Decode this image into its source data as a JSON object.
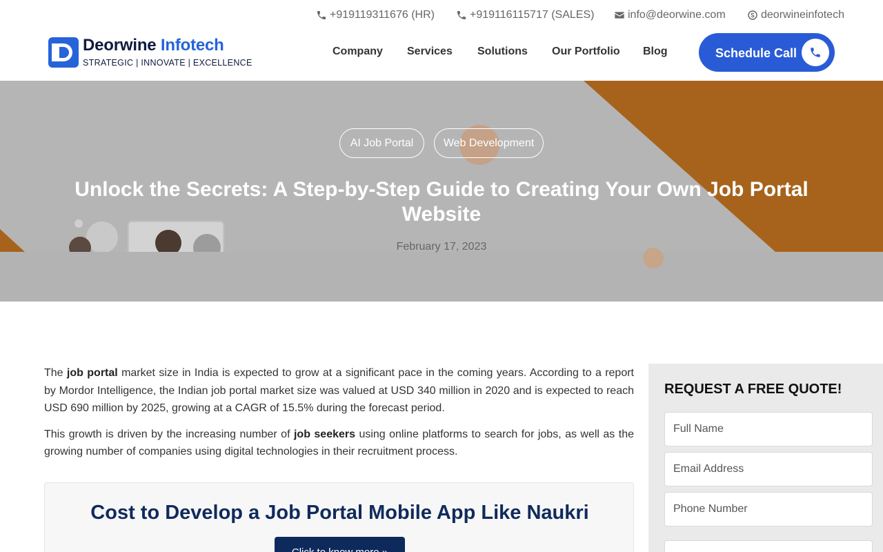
{
  "topbar": {
    "hr_phone": "+919119311676 (HR)",
    "sales_phone": "+919116115717 (SALES)",
    "email": "info@deorwine.com",
    "skype": "deorwineinfotech",
    "icons": [
      "phone-icon",
      "phone-icon",
      "envelope-icon",
      "skype-icon"
    ]
  },
  "brand": {
    "name_dark": "Deorwine",
    "name_accent": "Infotech",
    "tagline": "STRATEGIC | INNOVATE | EXCELLENCE",
    "color_dark": "#0e1b3d",
    "color_accent": "#2563d9"
  },
  "nav": {
    "items": [
      "Company",
      "Services",
      "Solutions",
      "Our Portfolio",
      "Blog"
    ]
  },
  "cta": {
    "label": "Schedule Call",
    "icon": "phone-icon",
    "color": "#2a5bd7"
  },
  "hero": {
    "tags": [
      "AI Job Portal",
      "Web Development"
    ],
    "title": "Unlock the Secrets: A Step-by-Step Guide to Creating Your Own Job Portal Website",
    "date": "February 17, 2023",
    "accent_color": "#a7631b"
  },
  "article": {
    "p1": {
      "pre": "The ",
      "bold": "job portal",
      "post": " market size in India is expected to grow at a significant pace in the coming years. According to a report by Mordor Intelligence, the Indian job portal market size was valued at USD 340 million in 2020 and is expected to reach USD 690 million by 2025, growing at a CAGR of 15.5% during the forecast period."
    },
    "p2": {
      "pre": "This growth is driven by the increasing number of ",
      "bold": "job seekers",
      "post": " using online platforms to search for jobs, as well as the growing number of companies using digital technologies in their recruitment process."
    }
  },
  "promo": {
    "title": "Cost to Develop a Job Portal Mobile App Like Naukri",
    "button": "Click to know more  »"
  },
  "quote_form": {
    "title": "REQUEST A FREE QUOTE!",
    "full_name_placeholder": "Full Name",
    "email_placeholder": "Email Address",
    "phone_placeholder": "Phone Number"
  }
}
